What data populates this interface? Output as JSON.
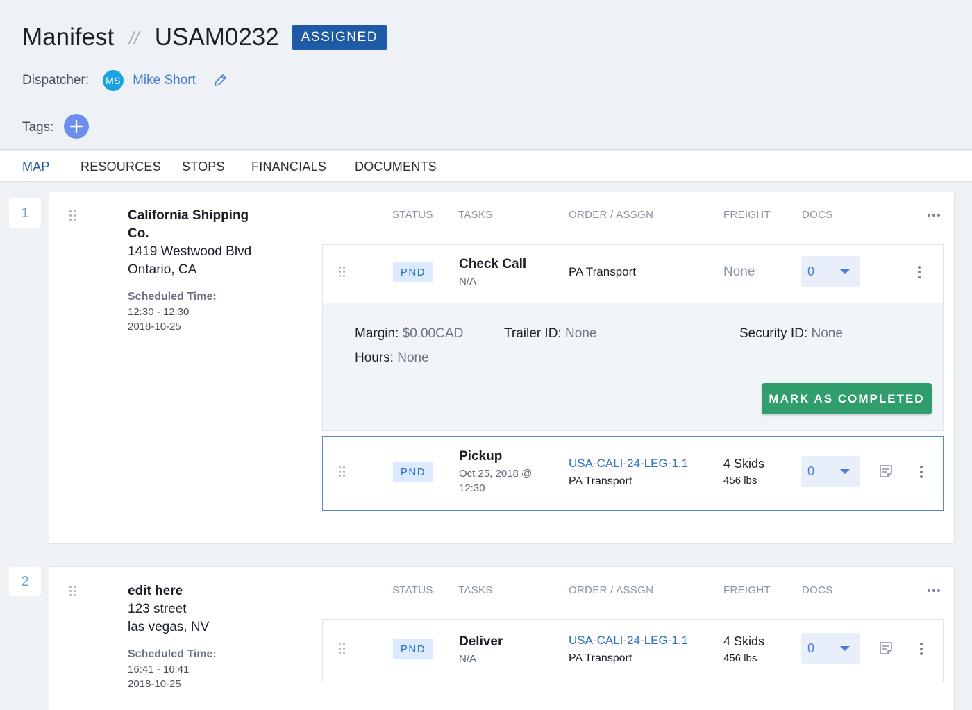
{
  "header": {
    "title": "Manifest",
    "separator": "//",
    "manifest_id": "USAM0232",
    "status_badge": "ASSIGNED",
    "dispatcher_label": "Dispatcher:",
    "dispatcher_initials": "MS",
    "dispatcher_name": "Mike Short"
  },
  "tags": {
    "label": "Tags:"
  },
  "tabs": [
    {
      "label": "MAP",
      "active": true
    },
    {
      "label": "RESOURCES"
    },
    {
      "label": "STOPS"
    },
    {
      "label": "FINANCIALS"
    },
    {
      "label": "DOCUMENTS"
    }
  ],
  "columns": {
    "status": "STATUS",
    "tasks": "TASKS",
    "order": "ORDER / ASSGN",
    "freight": "FREIGHT",
    "docs": "DOCS"
  },
  "stops": [
    {
      "number": "1",
      "name_line1": "California Shipping",
      "name_line2": "Co.",
      "address1": "1419 Westwood Blvd",
      "address2": "Ontario, CA",
      "scheduled_label": "Scheduled Time:",
      "scheduled_time": "12:30 - 12:30",
      "scheduled_date": "2018-10-25",
      "tasks": [
        {
          "status": "PND",
          "name": "Check Call",
          "sub": "N/A",
          "order": "PA Transport",
          "freight": "None",
          "docs": "0",
          "details": {
            "margin_label": "Margin:",
            "margin_value": "$0.00CAD",
            "trailer_label": "Trailer ID:",
            "trailer_value": "None",
            "security_label": "Security ID:",
            "security_value": "None",
            "hours_label": "Hours:",
            "hours_value": "None",
            "complete_button": "MARK AS COMPLETED"
          }
        },
        {
          "status": "PND",
          "name": "Pickup",
          "sub_line1": "Oct 25, 2018 @",
          "sub_line2": "12:30",
          "order": "USA-CALI-24-LEG-1.1",
          "assignee": "PA Transport",
          "freight": "4 Skids",
          "weight": "456 lbs",
          "docs": "0"
        }
      ]
    },
    {
      "number": "2",
      "name_line1": "edit here",
      "address1": "123 street",
      "address2": "las vegas, NV",
      "scheduled_label": "Scheduled Time:",
      "scheduled_time": "16:41 - 16:41",
      "scheduled_date": "2018-10-25",
      "tasks": [
        {
          "status": "PND",
          "name": "Deliver",
          "sub": "N/A",
          "order": "USA-CALI-24-LEG-1.1",
          "assignee": "PA Transport",
          "freight": "4 Skids",
          "weight": "456 lbs",
          "docs": "0"
        }
      ]
    }
  ],
  "colors": {
    "badge": "#1f5aa6",
    "accent": "#4a7cd6",
    "complete_button": "#2f9e6c",
    "pnd_bg": "#dbeafc"
  }
}
